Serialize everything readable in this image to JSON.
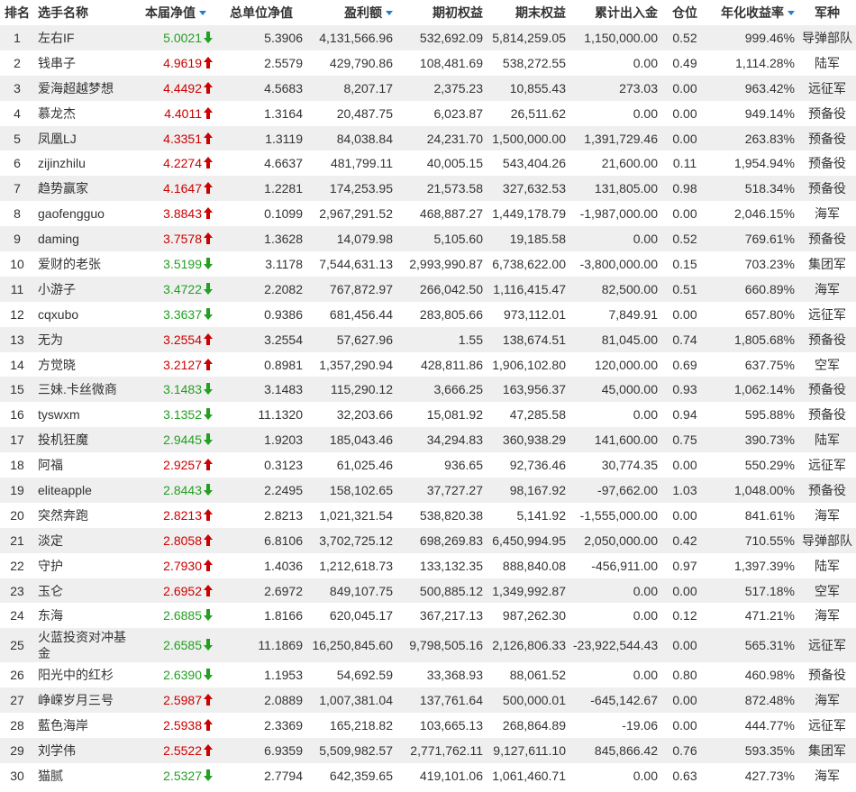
{
  "colors": {
    "up": "#cc0000",
    "down": "#22a022",
    "sort": "#1e7fd0",
    "stripe": "#efefef"
  },
  "headers": {
    "rank": "排名",
    "name": "选手名称",
    "nav": "本届净值",
    "unit_nav": "总单位净值",
    "profit": "盈利额",
    "start_equity": "期初权益",
    "end_equity": "期末权益",
    "net_flow": "累计出入金",
    "position": "仓位",
    "annual_return": "年化收益率",
    "group": "军种"
  },
  "rows": [
    {
      "rank": "1",
      "name": "左右IF",
      "nav": "5.0021",
      "dir": "down",
      "unit_nav": "5.3906",
      "profit": "4,131,566.96",
      "start": "532,692.09",
      "end": "5,814,259.05",
      "flow": "1,150,000.00",
      "pos": "0.52",
      "annual": "999.46%",
      "group": "导弹部队"
    },
    {
      "rank": "2",
      "name": "钱串子",
      "nav": "4.9619",
      "dir": "up",
      "unit_nav": "2.5579",
      "profit": "429,790.86",
      "start": "108,481.69",
      "end": "538,272.55",
      "flow": "0.00",
      "pos": "0.49",
      "annual": "1,114.28%",
      "group": "陆军"
    },
    {
      "rank": "3",
      "name": "爱海超越梦想",
      "nav": "4.4492",
      "dir": "up",
      "unit_nav": "4.5683",
      "profit": "8,207.17",
      "start": "2,375.23",
      "end": "10,855.43",
      "flow": "273.03",
      "pos": "0.00",
      "annual": "963.42%",
      "group": "远征军"
    },
    {
      "rank": "4",
      "name": "慕龙杰",
      "nav": "4.4011",
      "dir": "up",
      "unit_nav": "1.3164",
      "profit": "20,487.75",
      "start": "6,023.87",
      "end": "26,511.62",
      "flow": "0.00",
      "pos": "0.00",
      "annual": "949.14%",
      "group": "预备役"
    },
    {
      "rank": "5",
      "name": "凤凰LJ",
      "nav": "4.3351",
      "dir": "up",
      "unit_nav": "1.3119",
      "profit": "84,038.84",
      "start": "24,231.70",
      "end": "1,500,000.00",
      "flow": "1,391,729.46",
      "pos": "0.00",
      "annual": "263.83%",
      "group": "预备役"
    },
    {
      "rank": "6",
      "name": "zijinzhilu",
      "nav": "4.2274",
      "dir": "up",
      "unit_nav": "4.6637",
      "profit": "481,799.11",
      "start": "40,005.15",
      "end": "543,404.26",
      "flow": "21,600.00",
      "pos": "0.11",
      "annual": "1,954.94%",
      "group": "预备役"
    },
    {
      "rank": "7",
      "name": "趋势赢家",
      "nav": "4.1647",
      "dir": "up",
      "unit_nav": "1.2281",
      "profit": "174,253.95",
      "start": "21,573.58",
      "end": "327,632.53",
      "flow": "131,805.00",
      "pos": "0.98",
      "annual": "518.34%",
      "group": "预备役"
    },
    {
      "rank": "8",
      "name": "gaofengguo",
      "nav": "3.8843",
      "dir": "up",
      "unit_nav": "0.1099",
      "profit": "2,967,291.52",
      "start": "468,887.27",
      "end": "1,449,178.79",
      "flow": "-1,987,000.00",
      "pos": "0.00",
      "annual": "2,046.15%",
      "group": "海军"
    },
    {
      "rank": "9",
      "name": "daming",
      "nav": "3.7578",
      "dir": "up",
      "unit_nav": "1.3628",
      "profit": "14,079.98",
      "start": "5,105.60",
      "end": "19,185.58",
      "flow": "0.00",
      "pos": "0.52",
      "annual": "769.61%",
      "group": "预备役"
    },
    {
      "rank": "10",
      "name": "爱财的老张",
      "nav": "3.5199",
      "dir": "down",
      "unit_nav": "3.1178",
      "profit": "7,544,631.13",
      "start": "2,993,990.87",
      "end": "6,738,622.00",
      "flow": "-3,800,000.00",
      "pos": "0.15",
      "annual": "703.23%",
      "group": "集团军"
    },
    {
      "rank": "11",
      "name": "小游子",
      "nav": "3.4722",
      "dir": "down",
      "unit_nav": "2.2082",
      "profit": "767,872.97",
      "start": "266,042.50",
      "end": "1,116,415.47",
      "flow": "82,500.00",
      "pos": "0.51",
      "annual": "660.89%",
      "group": "海军"
    },
    {
      "rank": "12",
      "name": "cqxubo",
      "nav": "3.3637",
      "dir": "down",
      "unit_nav": "0.9386",
      "profit": "681,456.44",
      "start": "283,805.66",
      "end": "973,112.01",
      "flow": "7,849.91",
      "pos": "0.00",
      "annual": "657.80%",
      "group": "远征军"
    },
    {
      "rank": "13",
      "name": "无为",
      "nav": "3.2554",
      "dir": "up",
      "unit_nav": "3.2554",
      "profit": "57,627.96",
      "start": "1.55",
      "end": "138,674.51",
      "flow": "81,045.00",
      "pos": "0.74",
      "annual": "1,805.68%",
      "group": "预备役"
    },
    {
      "rank": "14",
      "name": "方觉晓",
      "nav": "3.2127",
      "dir": "up",
      "unit_nav": "0.8981",
      "profit": "1,357,290.94",
      "start": "428,811.86",
      "end": "1,906,102.80",
      "flow": "120,000.00",
      "pos": "0.69",
      "annual": "637.75%",
      "group": "空军"
    },
    {
      "rank": "15",
      "name": "三妹.卡丝微商",
      "nav": "3.1483",
      "dir": "down",
      "unit_nav": "3.1483",
      "profit": "115,290.12",
      "start": "3,666.25",
      "end": "163,956.37",
      "flow": "45,000.00",
      "pos": "0.93",
      "annual": "1,062.14%",
      "group": "预备役"
    },
    {
      "rank": "16",
      "name": "tyswxm",
      "nav": "3.1352",
      "dir": "down",
      "unit_nav": "11.1320",
      "profit": "32,203.66",
      "start": "15,081.92",
      "end": "47,285.58",
      "flow": "0.00",
      "pos": "0.94",
      "annual": "595.88%",
      "group": "预备役"
    },
    {
      "rank": "17",
      "name": "投机狂魔",
      "nav": "2.9445",
      "dir": "down",
      "unit_nav": "1.9203",
      "profit": "185,043.46",
      "start": "34,294.83",
      "end": "360,938.29",
      "flow": "141,600.00",
      "pos": "0.75",
      "annual": "390.73%",
      "group": "陆军"
    },
    {
      "rank": "18",
      "name": "阿福",
      "nav": "2.9257",
      "dir": "up",
      "unit_nav": "0.3123",
      "profit": "61,025.46",
      "start": "936.65",
      "end": "92,736.46",
      "flow": "30,774.35",
      "pos": "0.00",
      "annual": "550.29%",
      "group": "远征军"
    },
    {
      "rank": "19",
      "name": "eliteapple",
      "nav": "2.8443",
      "dir": "down",
      "unit_nav": "2.2495",
      "profit": "158,102.65",
      "start": "37,727.27",
      "end": "98,167.92",
      "flow": "-97,662.00",
      "pos": "1.03",
      "annual": "1,048.00%",
      "group": "预备役"
    },
    {
      "rank": "20",
      "name": "突然奔跑",
      "nav": "2.8213",
      "dir": "up",
      "unit_nav": "2.8213",
      "profit": "1,021,321.54",
      "start": "538,820.38",
      "end": "5,141.92",
      "flow": "-1,555,000.00",
      "pos": "0.00",
      "annual": "841.61%",
      "group": "海军"
    },
    {
      "rank": "21",
      "name": "淡定",
      "nav": "2.8058",
      "dir": "up",
      "unit_nav": "6.8106",
      "profit": "3,702,725.12",
      "start": "698,269.83",
      "end": "6,450,994.95",
      "flow": "2,050,000.00",
      "pos": "0.42",
      "annual": "710.55%",
      "group": "导弹部队"
    },
    {
      "rank": "22",
      "name": "守护",
      "nav": "2.7930",
      "dir": "up",
      "unit_nav": "1.4036",
      "profit": "1,212,618.73",
      "start": "133,132.35",
      "end": "888,840.08",
      "flow": "-456,911.00",
      "pos": "0.97",
      "annual": "1,397.39%",
      "group": "陆军"
    },
    {
      "rank": "23",
      "name": "玉仑",
      "nav": "2.6952",
      "dir": "up",
      "unit_nav": "2.6972",
      "profit": "849,107.75",
      "start": "500,885.12",
      "end": "1,349,992.87",
      "flow": "0.00",
      "pos": "0.00",
      "annual": "517.18%",
      "group": "空军"
    },
    {
      "rank": "24",
      "name": "东海",
      "nav": "2.6885",
      "dir": "down",
      "unit_nav": "1.8166",
      "profit": "620,045.17",
      "start": "367,217.13",
      "end": "987,262.30",
      "flow": "0.00",
      "pos": "0.12",
      "annual": "471.21%",
      "group": "海军"
    },
    {
      "rank": "25",
      "name": "火蓝投资对冲基金",
      "nav": "2.6585",
      "dir": "down",
      "unit_nav": "11.1869",
      "profit": "16,250,845.60",
      "start": "9,798,505.16",
      "end": "2,126,806.33",
      "flow": "-23,922,544.43",
      "pos": "0.00",
      "annual": "565.31%",
      "group": "远征军",
      "tall": true
    },
    {
      "rank": "26",
      "name": "阳光中的红杉",
      "nav": "2.6390",
      "dir": "down",
      "unit_nav": "1.1953",
      "profit": "54,692.59",
      "start": "33,368.93",
      "end": "88,061.52",
      "flow": "0.00",
      "pos": "0.80",
      "annual": "460.98%",
      "group": "预备役"
    },
    {
      "rank": "27",
      "name": "峥嵘岁月三号",
      "nav": "2.5987",
      "dir": "up",
      "unit_nav": "2.0889",
      "profit": "1,007,381.04",
      "start": "137,761.64",
      "end": "500,000.01",
      "flow": "-645,142.67",
      "pos": "0.00",
      "annual": "872.48%",
      "group": "海军"
    },
    {
      "rank": "28",
      "name": "藍色海岸",
      "nav": "2.5938",
      "dir": "up",
      "unit_nav": "2.3369",
      "profit": "165,218.82",
      "start": "103,665.13",
      "end": "268,864.89",
      "flow": "-19.06",
      "pos": "0.00",
      "annual": "444.77%",
      "group": "远征军"
    },
    {
      "rank": "29",
      "name": "刘学伟",
      "nav": "2.5522",
      "dir": "up",
      "unit_nav": "6.9359",
      "profit": "5,509,982.57",
      "start": "2,771,762.11",
      "end": "9,127,611.10",
      "flow": "845,866.42",
      "pos": "0.76",
      "annual": "593.35%",
      "group": "集团军"
    },
    {
      "rank": "30",
      "name": "猫腻",
      "nav": "2.5327",
      "dir": "down",
      "unit_nav": "2.7794",
      "profit": "642,359.65",
      "start": "419,101.06",
      "end": "1,061,460.71",
      "flow": "0.00",
      "pos": "0.63",
      "annual": "427.73%",
      "group": "海军"
    }
  ]
}
